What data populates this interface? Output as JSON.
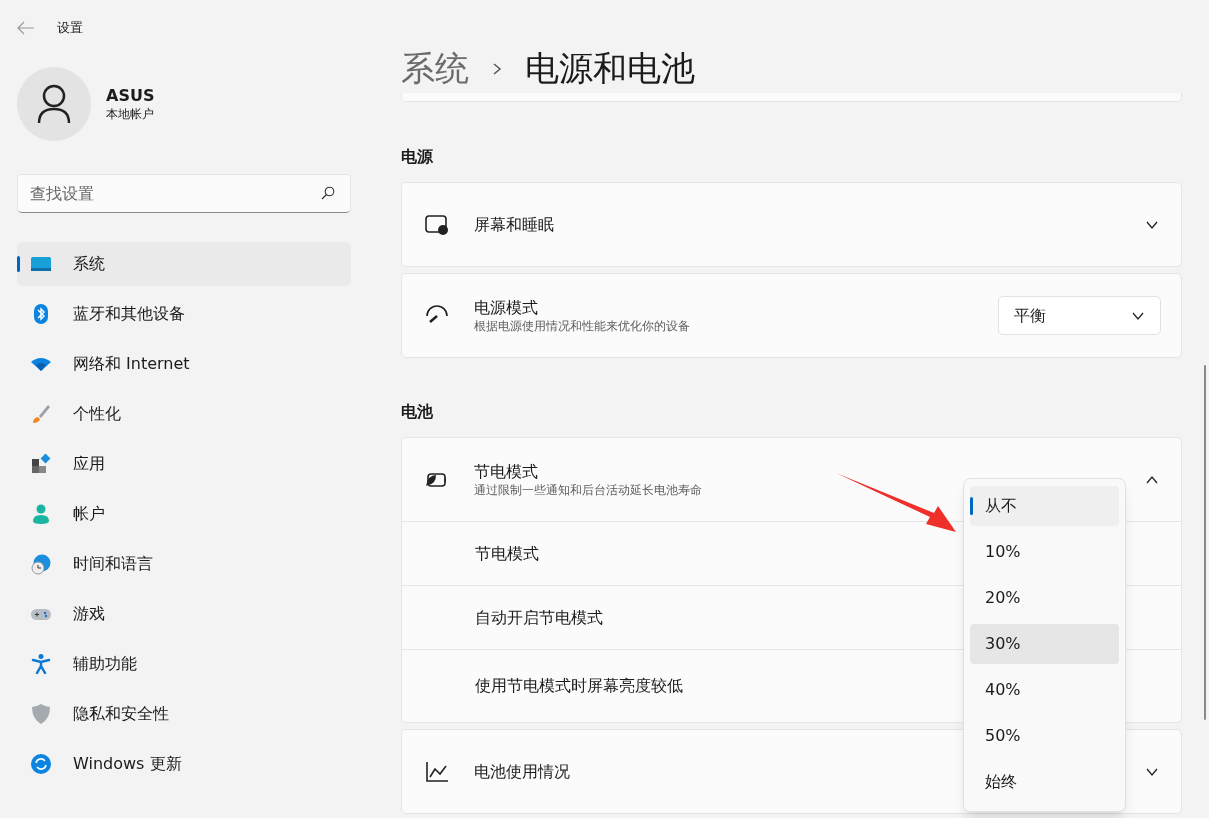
{
  "window": {
    "title": "设置"
  },
  "user": {
    "name": "ASUS",
    "account": "本地帐户"
  },
  "search": {
    "placeholder": "查找设置"
  },
  "nav": [
    {
      "label": "系统",
      "selected": true
    },
    {
      "label": "蓝牙和其他设备",
      "selected": false
    },
    {
      "label": "网络和 Internet",
      "selected": false
    },
    {
      "label": "个性化",
      "selected": false
    },
    {
      "label": "应用",
      "selected": false
    },
    {
      "label": "帐户",
      "selected": false
    },
    {
      "label": "时间和语言",
      "selected": false
    },
    {
      "label": "游戏",
      "selected": false
    },
    {
      "label": "辅助功能",
      "selected": false
    },
    {
      "label": "隐私和安全性",
      "selected": false
    },
    {
      "label": "Windows 更新",
      "selected": false
    }
  ],
  "breadcrumb": {
    "parent": "系统",
    "current": "电源和电池"
  },
  "sections": [
    {
      "heading": "电源",
      "cards": [
        {
          "kind": "expander",
          "title": "屏幕和睡眠",
          "expanded": false
        },
        {
          "kind": "combo",
          "title": "电源模式",
          "description": "根据电源使用情况和性能来优化你的设备",
          "value": "平衡"
        }
      ]
    },
    {
      "heading": "电池",
      "cards": [
        {
          "kind": "expander",
          "title": "节电模式",
          "description": "通过限制一些通知和后台活动延长电池寿命",
          "expanded": true,
          "children": [
            {
              "label": "节电模式"
            },
            {
              "label": "自动开启节电模式"
            },
            {
              "label": "使用节电模式时屏幕亮度较低"
            }
          ]
        },
        {
          "kind": "expander",
          "title": "电池使用情况",
          "expanded": false
        }
      ]
    }
  ],
  "dropdown": {
    "options": [
      {
        "label": "从不",
        "selected": true,
        "hovered": false
      },
      {
        "label": "10%",
        "selected": false,
        "hovered": false
      },
      {
        "label": "20%",
        "selected": false,
        "hovered": false
      },
      {
        "label": "30%",
        "selected": false,
        "hovered": true
      },
      {
        "label": "40%",
        "selected": false,
        "hovered": false
      },
      {
        "label": "50%",
        "selected": false,
        "hovered": false
      },
      {
        "label": "始终",
        "selected": false,
        "hovered": false
      }
    ]
  }
}
